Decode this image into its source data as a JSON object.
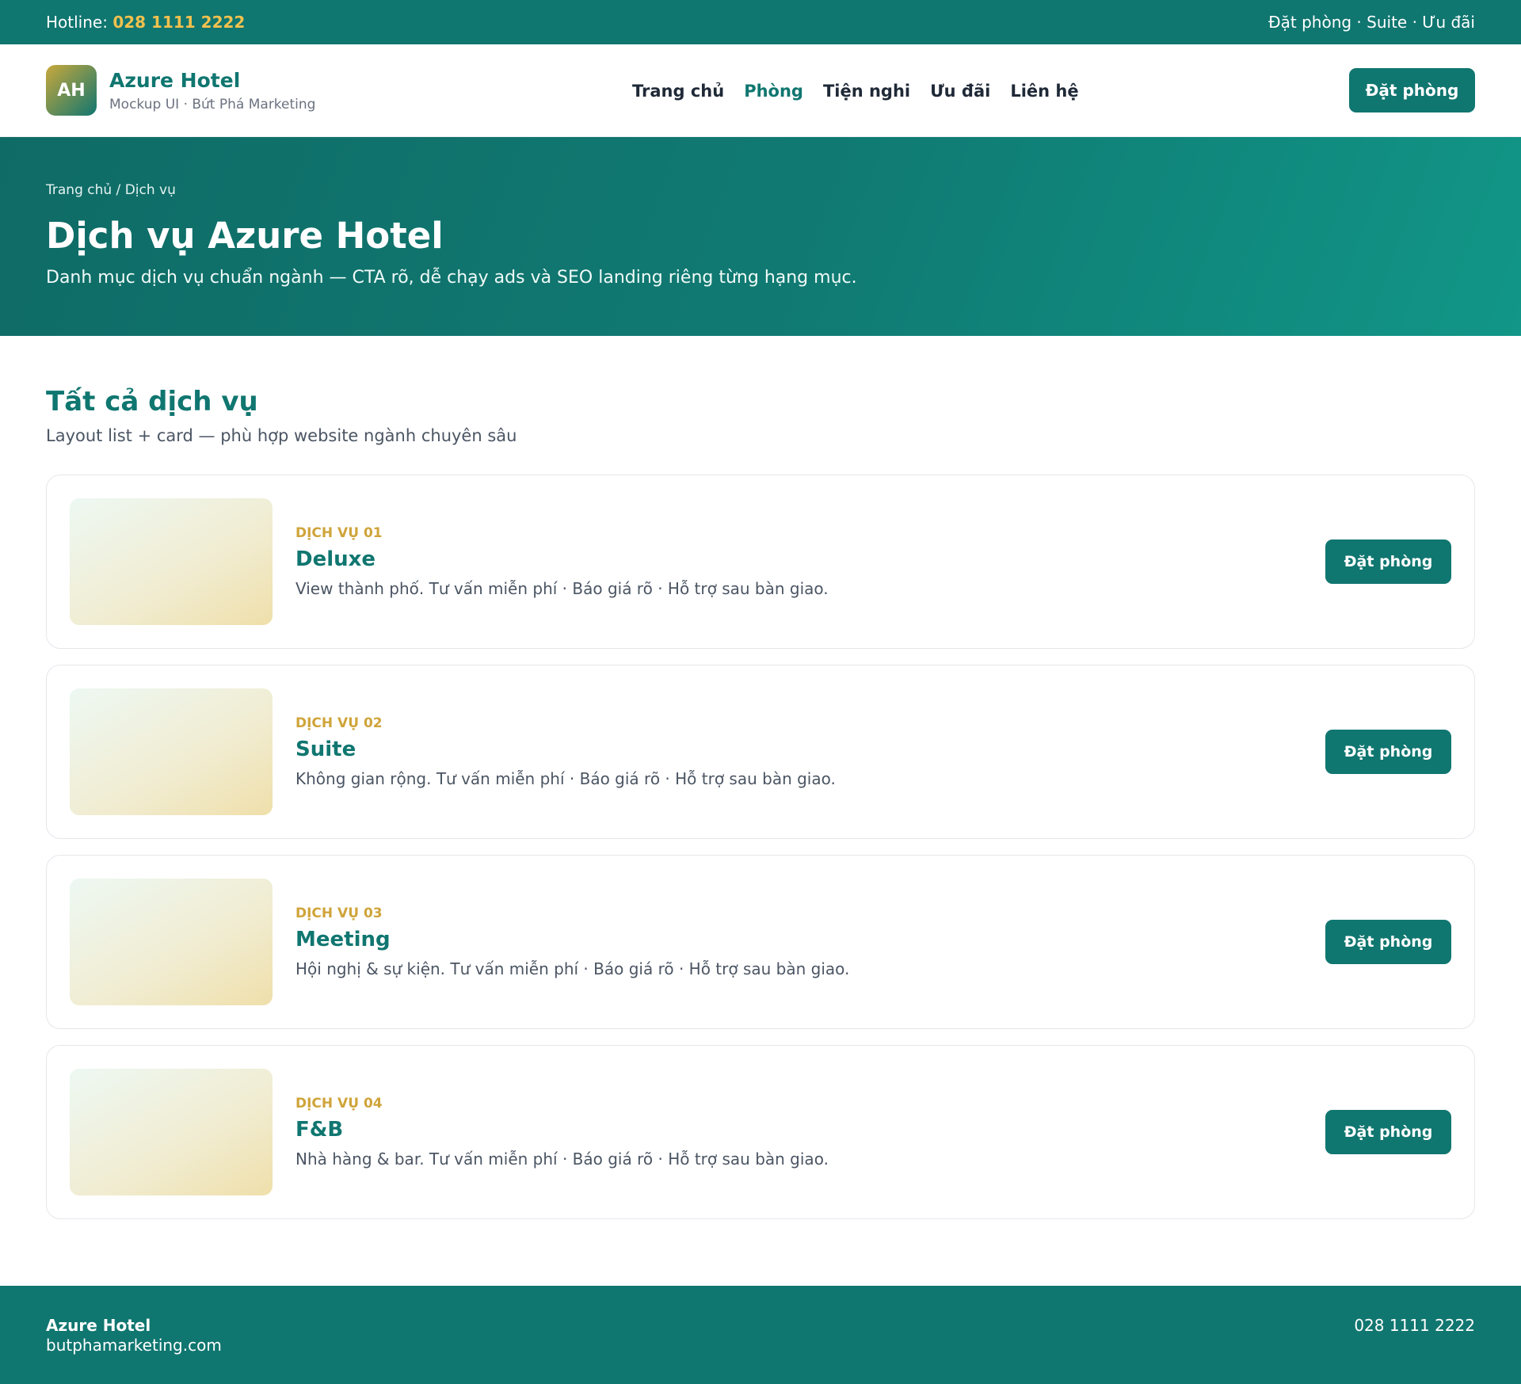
{
  "topbar": {
    "hotline_label": "Hotline:",
    "hotline_number": "028 1111 2222",
    "links": "Đặt phòng · Suite · Ưu đãi"
  },
  "header": {
    "logo_initials": "AH",
    "brand_name": "Azure Hotel",
    "brand_sub": "Mockup UI · Bứt Phá Marketing",
    "nav": [
      "Trang chủ",
      "Phòng",
      "Tiện nghi",
      "Ưu đãi",
      "Liên hệ"
    ],
    "active_nav": "Phòng",
    "cta_label": "Đặt phòng"
  },
  "hero": {
    "breadcrumb": "Trang chủ / Dịch vụ",
    "title": "Dịch vụ Azure Hotel",
    "subtitle": "Danh mục dịch vụ chuẩn ngành — CTA rõ, dễ chạy ads và SEO landing riêng từng hạng mục."
  },
  "section": {
    "title": "Tất cả dịch vụ",
    "subtitle": "Layout list + card — phù hợp website ngành chuyên sâu"
  },
  "services": [
    {
      "tag": "DỊCH VỤ 01",
      "name": "Deluxe",
      "desc": "View thành phố. Tư vấn miễn phí · Báo giá rõ · Hỗ trợ sau bàn giao.",
      "cta": "Đặt phòng"
    },
    {
      "tag": "DỊCH VỤ 02",
      "name": "Suite",
      "desc": "Không gian rộng. Tư vấn miễn phí · Báo giá rõ · Hỗ trợ sau bàn giao.",
      "cta": "Đặt phòng"
    },
    {
      "tag": "DỊCH VỤ 03",
      "name": "Meeting",
      "desc": "Hội nghị & sự kiện. Tư vấn miễn phí · Báo giá rõ · Hỗ trợ sau bàn giao.",
      "cta": "Đặt phòng"
    },
    {
      "tag": "DỊCH VỤ 04",
      "name": "F&B",
      "desc": "Nhà hàng & bar. Tư vấn miễn phí · Báo giá rõ · Hỗ trợ sau bàn giao.",
      "cta": "Đặt phòng"
    }
  ],
  "footer": {
    "brand": "Azure Hotel",
    "website": "butphamarketing.com",
    "phone": "028 1111 2222"
  },
  "colors": {
    "primary": "#107670",
    "accent": "#f2c14e",
    "tag": "#cfa43a"
  }
}
